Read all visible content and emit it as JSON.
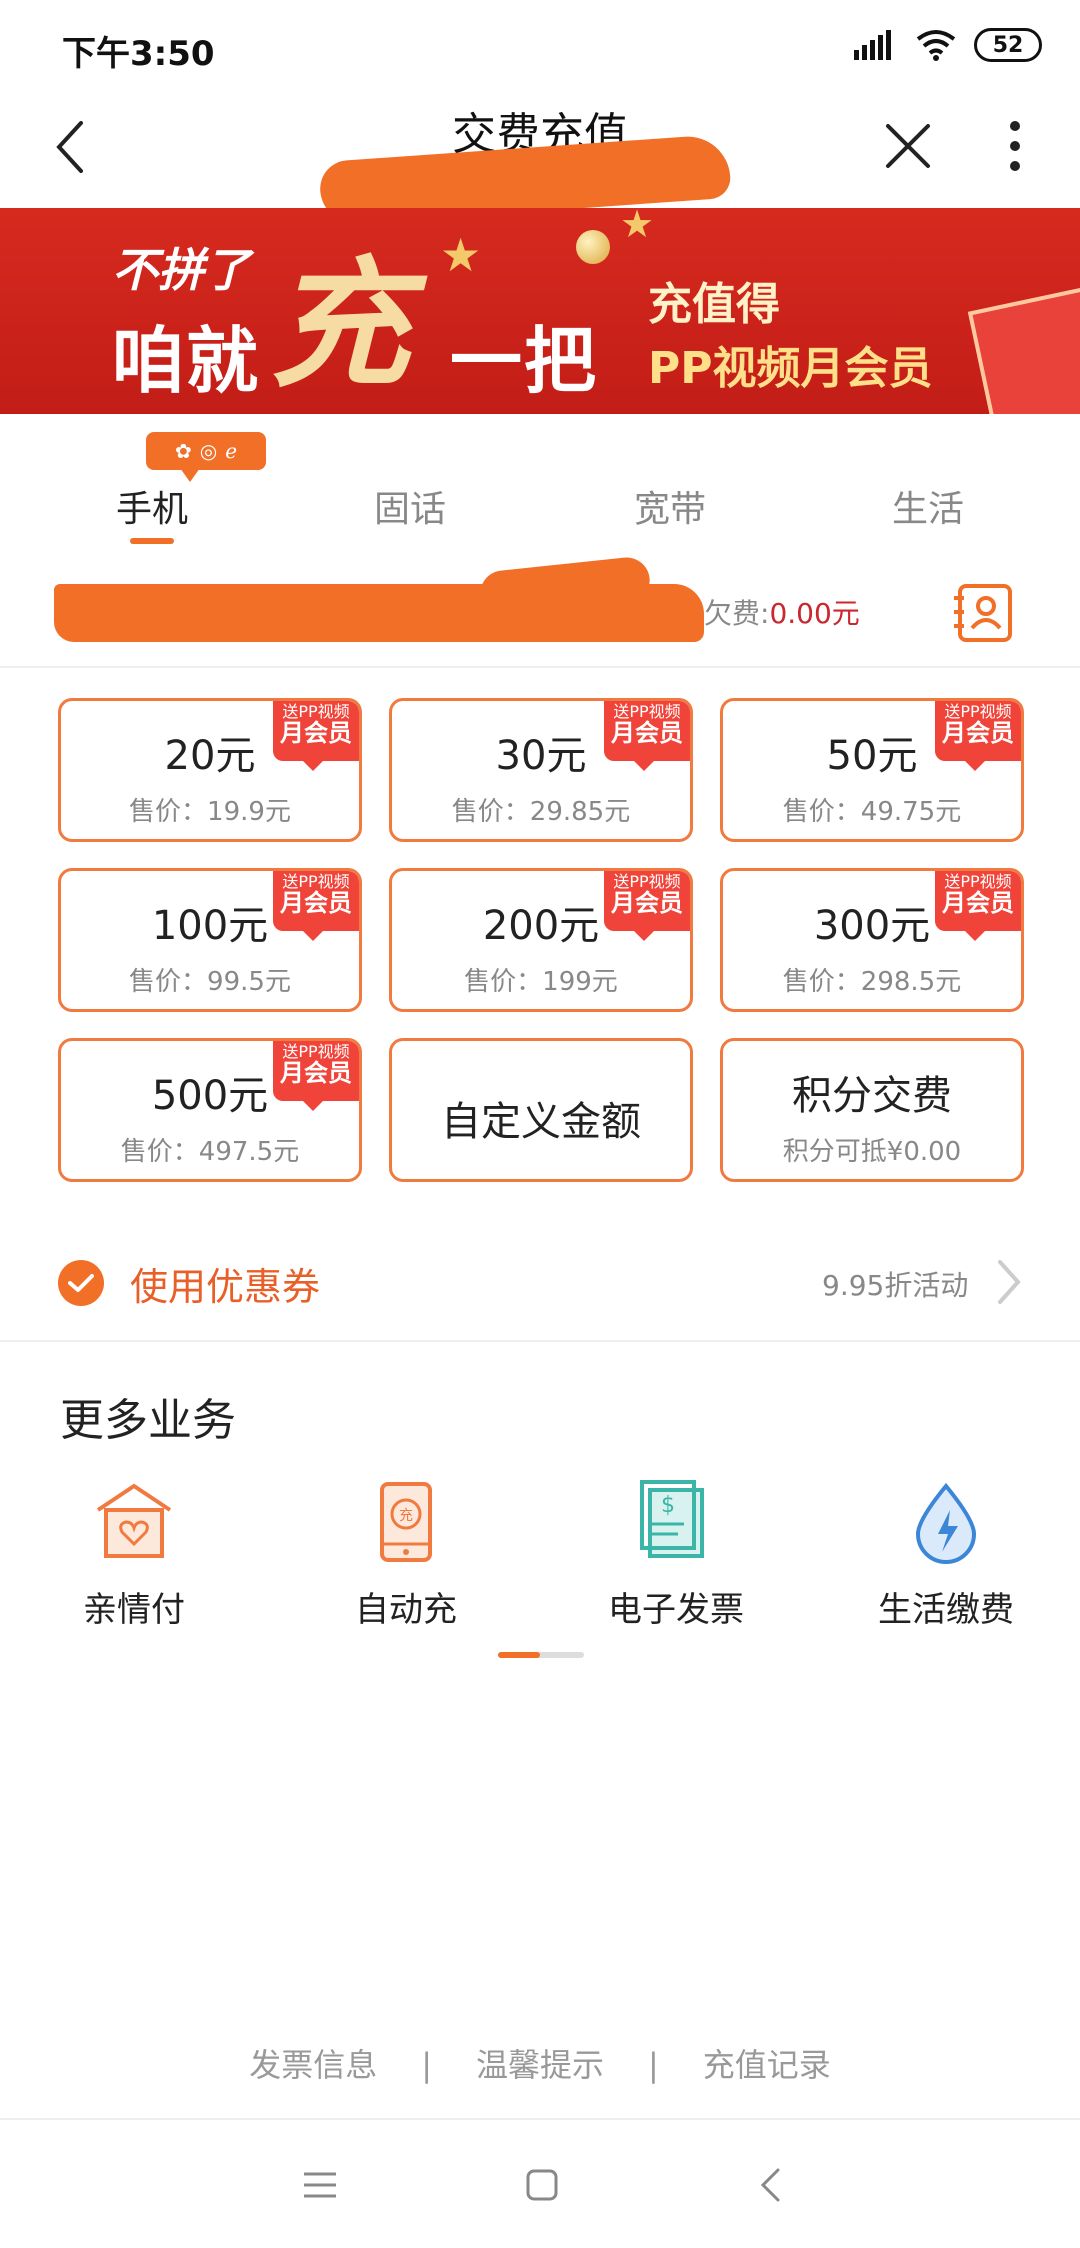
{
  "status_bar": {
    "time": "下午3:50",
    "battery": "52",
    "icons": [
      "signal-icon",
      "wifi-icon",
      "battery-icon"
    ]
  },
  "header": {
    "title": "交费充值",
    "back_icon": "chevron-left-icon",
    "close_icon": "close-icon",
    "more_icon": "more-vertical-icon"
  },
  "banner": {
    "line1": "不拼了",
    "big_char": "充",
    "line2_a": "咱就",
    "line2_b": "一把",
    "right_line1": "充值得",
    "right_line2": "PP视频月会员"
  },
  "tabs": [
    {
      "label": "手机",
      "active": true
    },
    {
      "label": "固话",
      "active": false
    },
    {
      "label": "宽带",
      "active": false
    },
    {
      "label": "生活",
      "active": false
    }
  ],
  "phone": {
    "arrears_prefix": "月欠费:",
    "arrears_amount": "0.00元"
  },
  "tag": {
    "line1": "送PP视频",
    "line2": "月会员"
  },
  "cards": [
    {
      "title": "20元",
      "sub": "售价：19.9元"
    },
    {
      "title": "30元",
      "sub": "售价：29.85元"
    },
    {
      "title": "50元",
      "sub": "售价：49.75元"
    },
    {
      "title": "100元",
      "sub": "售价：99.5元"
    },
    {
      "title": "200元",
      "sub": "售价：199元"
    },
    {
      "title": "300元",
      "sub": "售价：298.5元"
    },
    {
      "title": "500元",
      "sub": "售价：497.5元"
    },
    {
      "title": "自定义金额",
      "sub": ""
    },
    {
      "title": "积分交费",
      "sub": "积分可抵¥0.00"
    }
  ],
  "coupon": {
    "label": "使用优惠券",
    "note": "9.95折活动",
    "checked": true
  },
  "more": {
    "title": "更多业务",
    "services": [
      {
        "label": "亲情付",
        "icon": "house-heart-icon"
      },
      {
        "label": "自动充",
        "icon": "auto-recharge-icon"
      },
      {
        "label": "电子发票",
        "icon": "receipt-icon"
      },
      {
        "label": "生活缴费",
        "icon": "water-drop-icon"
      }
    ]
  },
  "footer": {
    "links": [
      "发票信息",
      "温馨提示",
      "充值记录"
    ],
    "separator": "|"
  },
  "colors": {
    "accent": "#f26f27",
    "tag_red": "#f0443a",
    "banner_red": "#c21d17",
    "price_red": "#c8282e"
  }
}
